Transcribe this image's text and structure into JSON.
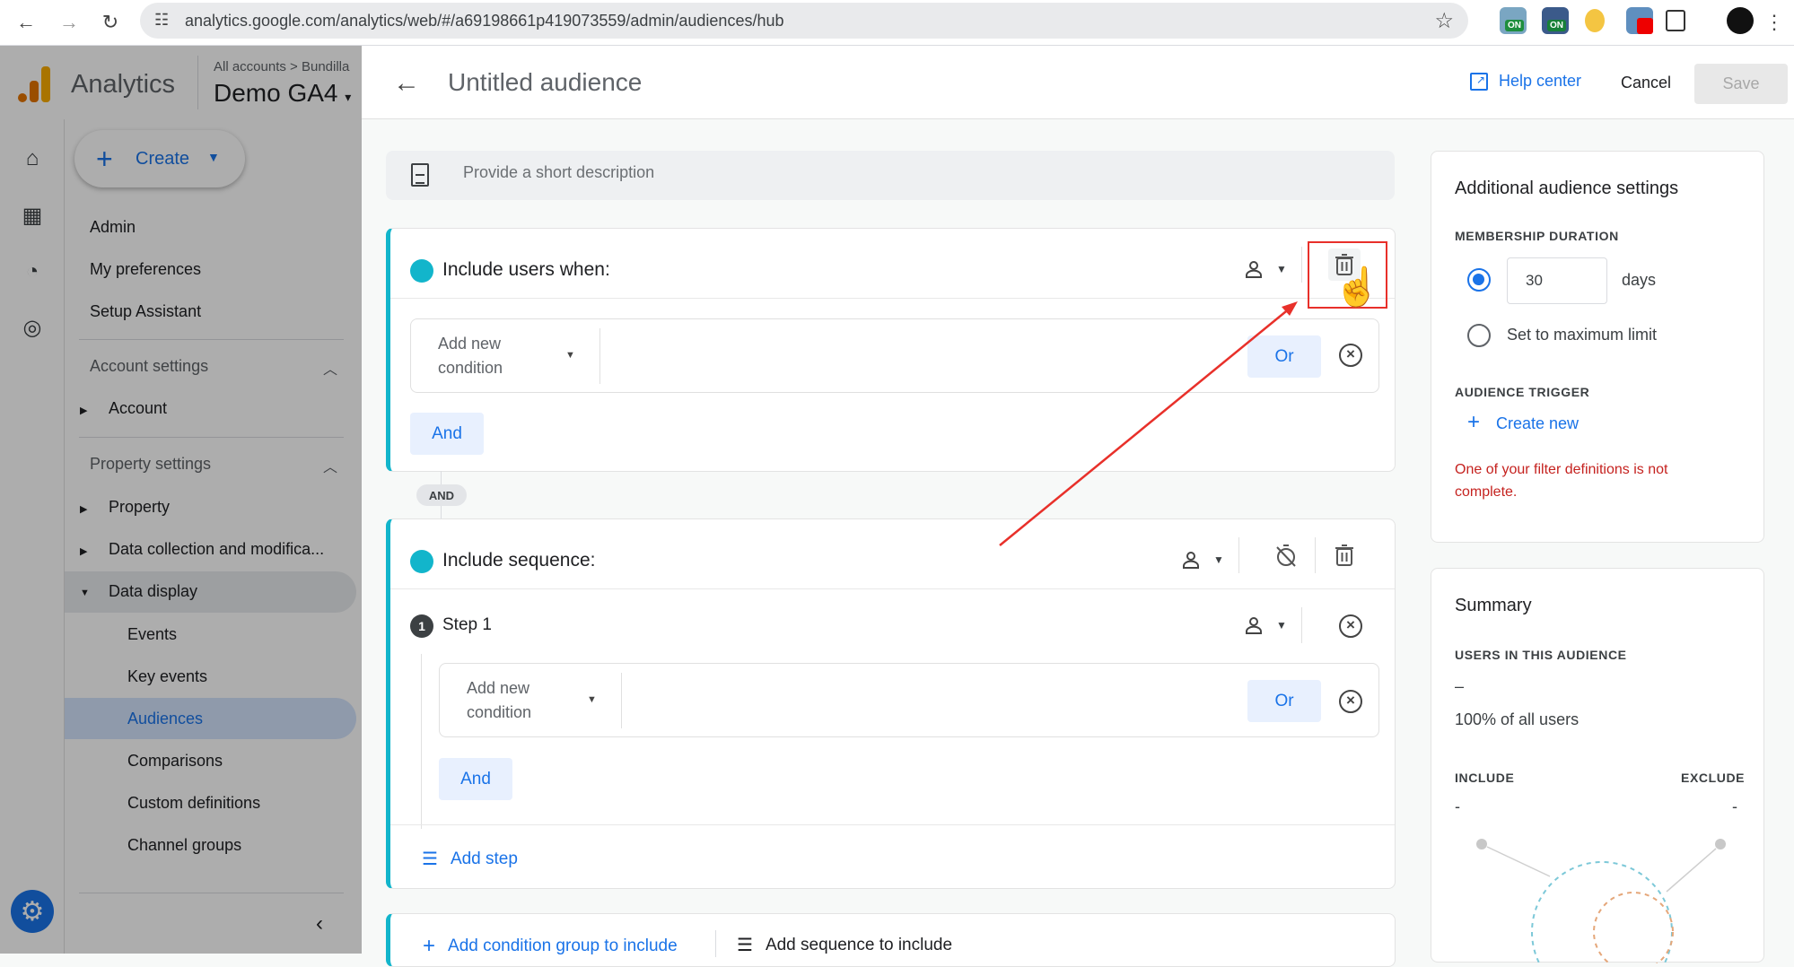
{
  "browser": {
    "url": "analytics.google.com/analytics/web/#/a69198661p419073559/admin/audiences/hub",
    "extensions": [
      {
        "name": "extension-1",
        "badge": "ON",
        "badge_color": "#1e8e3e"
      },
      {
        "name": "extension-2",
        "badge": "ON",
        "badge_color": "#188038"
      },
      {
        "name": "extension-duck",
        "badge": ""
      },
      {
        "name": "extension-4",
        "badge": ""
      },
      {
        "name": "extensions-puzzle",
        "badge": ""
      }
    ]
  },
  "header": {
    "app_name": "Analytics",
    "breadcrumb": "All accounts > Bundilla",
    "property_name": "Demo GA4",
    "page_title": "Untitled audience",
    "help_center": "Help center",
    "cancel": "Cancel",
    "save": "Save"
  },
  "sidebar": {
    "create_label": "Create",
    "top_items": [
      "Admin",
      "My preferences",
      "Setup Assistant"
    ],
    "account_settings": {
      "label": "Account settings",
      "items": [
        "Account"
      ]
    },
    "property_settings": {
      "label": "Property settings",
      "items": [
        "Property",
        "Data collection and modifica...",
        "Data display"
      ]
    },
    "data_display_items": [
      "Events",
      "Key events",
      "Audiences",
      "Comparisons",
      "Custom definitions",
      "Channel groups"
    ],
    "active_item": "Audiences"
  },
  "main": {
    "description_placeholder": "Provide a short description",
    "include_users": {
      "title": "Include users when:",
      "condition_placeholder": "Add new condition",
      "or_label": "Or",
      "and_label": "And"
    },
    "and_connector": "AND",
    "include_sequence": {
      "title": "Include sequence:",
      "step_number": "1",
      "step_label": "Step 1",
      "condition_placeholder": "Add new condition",
      "or_label": "Or",
      "and_label": "And",
      "add_step": "Add step"
    },
    "add_condition_group": "Add condition group to include",
    "add_sequence": "Add sequence to include"
  },
  "settings_panel": {
    "title": "Additional audience settings",
    "membership_label": "MEMBERSHIP DURATION",
    "duration_value": "30",
    "duration_unit": "days",
    "max_limit_label": "Set to maximum limit",
    "selected_option": "days",
    "trigger_label": "AUDIENCE TRIGGER",
    "create_new": "Create new",
    "error": "One of your filter definitions is not complete."
  },
  "summary_panel": {
    "title": "Summary",
    "users_label": "USERS IN THIS AUDIENCE",
    "users_value": "–",
    "percent_text": "100% of all users",
    "include_label": "INCLUDE",
    "include_value": "-",
    "exclude_label": "EXCLUDE",
    "exclude_value": "-"
  },
  "colors": {
    "accent": "#1a73e8",
    "teal": "#12b5cb",
    "error": "#c5221f",
    "annotation": "#e8302a"
  }
}
